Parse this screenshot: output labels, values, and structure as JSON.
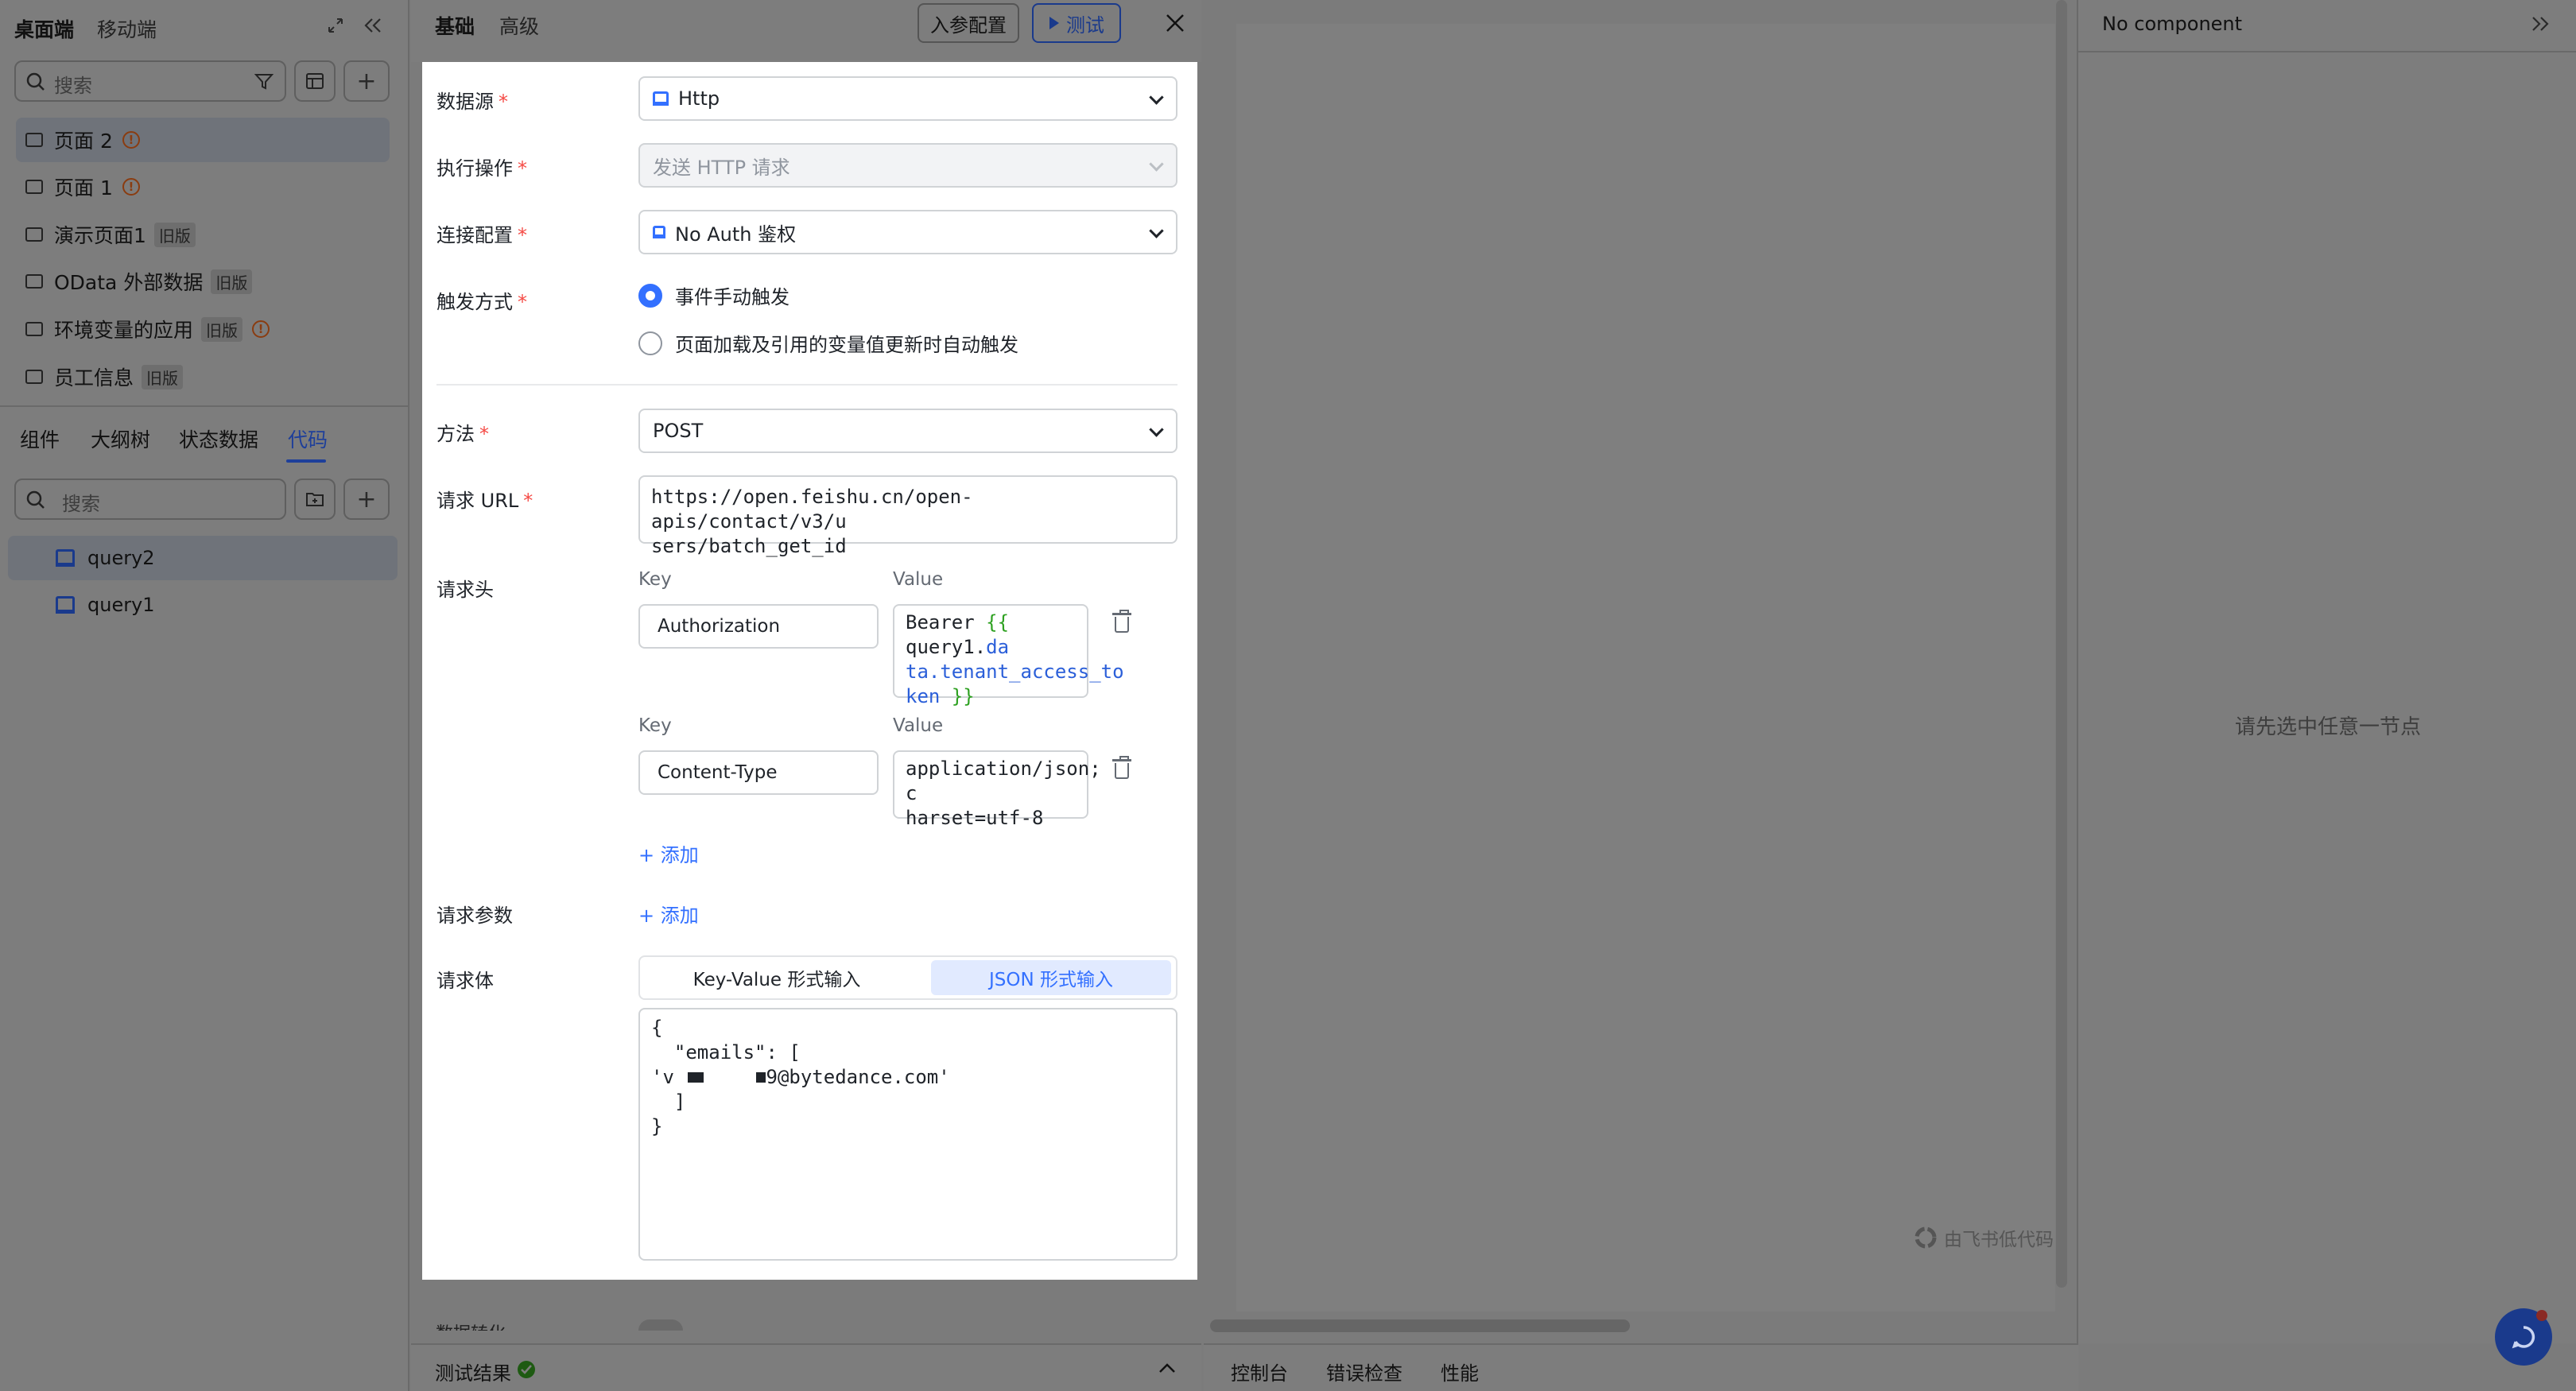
{
  "sidebar": {
    "top_tabs": [
      "桌面端",
      "移动端"
    ],
    "search_placeholder": "搜索",
    "pages": [
      {
        "label": "页面 2",
        "tag": "",
        "warn": true
      },
      {
        "label": "页面 1",
        "tag": "",
        "warn": true
      },
      {
        "label": "演示页面1",
        "tag": "旧版",
        "warn": false
      },
      {
        "label": "OData 外部数据",
        "tag": "旧版",
        "warn": false
      },
      {
        "label": "环境变量的应用",
        "tag": "旧版",
        "warn": true
      },
      {
        "label": "员工信息",
        "tag": "旧版",
        "warn": false
      }
    ],
    "bottom_tabs": [
      "组件",
      "大纲树",
      "状态数据",
      "代码"
    ],
    "code_search_placeholder": "搜索",
    "queries": [
      "query2",
      "query1"
    ]
  },
  "panel": {
    "tabs": [
      "基础",
      "高级"
    ],
    "param_config_button": "入参配置",
    "test_button": "测试",
    "fields": {
      "datasource_label": "数据源",
      "datasource_value": "Http",
      "action_label": "执行操作",
      "action_value": "发送 HTTP 请求",
      "connection_label": "连接配置",
      "connection_value": "No Auth 鉴权",
      "trigger_label": "触发方式",
      "trigger_options": [
        "事件手动触发",
        "页面加载及引用的变量值更新时自动触发"
      ],
      "method_label": "方法",
      "method_value": "POST",
      "url_label": "请求 URL",
      "url_lines": [
        "https://open.feishu.cn/open-apis/contact/v3/u",
        "sers/batch_get_id"
      ],
      "headers_label": "请求头",
      "key_col": "Key",
      "value_col": "Value",
      "header1_key": "Authorization",
      "header1_value_l1_plain": "Bearer ",
      "header1_value_l1_green": "{{ ",
      "header1_value_l1_blue1": "query1.",
      "header1_value_l1_blue2": "da",
      "header1_value_l2": "ta.tenant_access_to",
      "header1_value_l3_blue": "ken",
      "header1_value_l3_green": " }}",
      "header2_key": "Content-Type",
      "header2_value_lines": [
        "application/json; c",
        "harset=utf-8"
      ],
      "add_label": "添加",
      "params_label": "请求参数",
      "body_label": "请求体",
      "body_modes": [
        "Key-Value 形式输入",
        "JSON 形式输入"
      ],
      "body_lines": [
        "{",
        "  \"emails\": [",
        "'v        9@bytedance.com'",
        "  ]",
        "}"
      ],
      "transform_label": "数据转化"
    },
    "test_result_label": "测试结果"
  },
  "canvas": {
    "watermark": "由飞书低代码"
  },
  "right_panel": {
    "title": "No component",
    "empty_hint": "请先选中任意一节点"
  },
  "bottom_tabs": [
    "控制台",
    "错误检查",
    "性能"
  ],
  "colors": {
    "accent": "#3370ff",
    "required": "#f54a45",
    "success": "#2ea121"
  }
}
